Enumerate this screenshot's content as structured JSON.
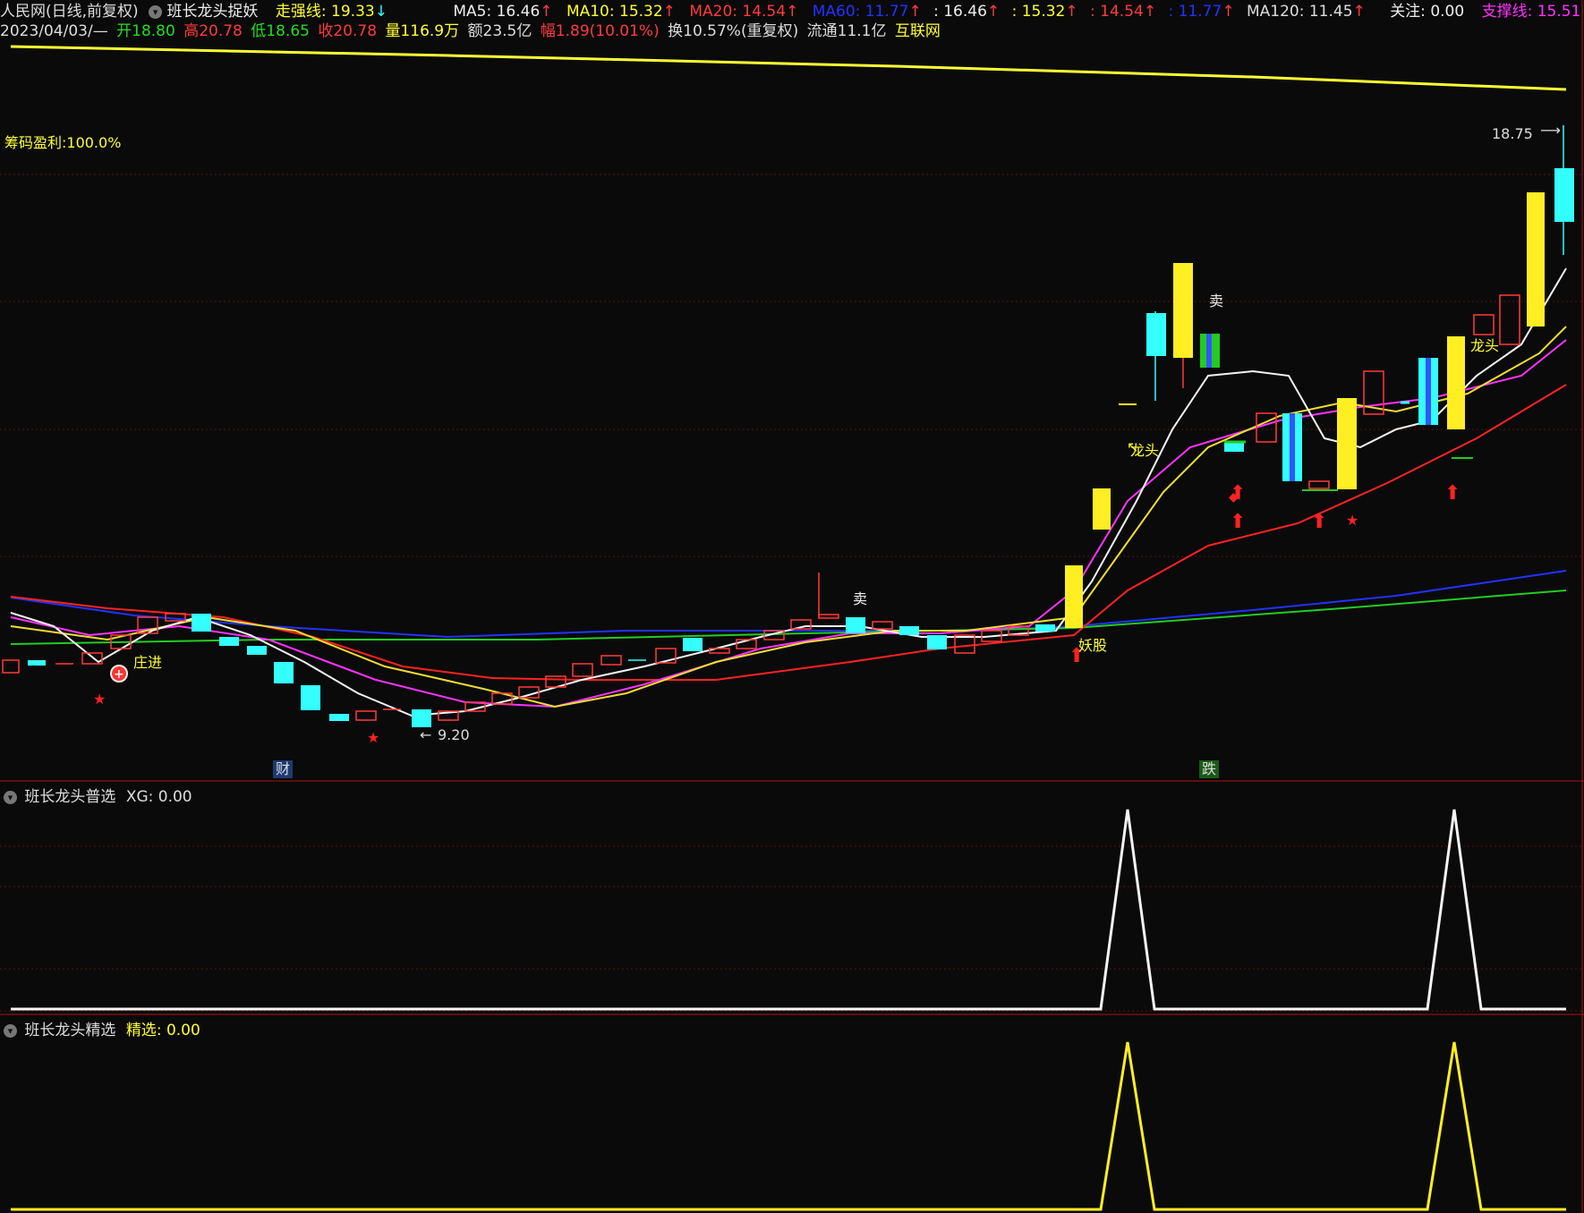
{
  "colors": {
    "bg": "#0a0a0a",
    "up": "#ff3b3b",
    "down": "#33ffff",
    "yellow": "#ffff33",
    "white": "#eeeeee",
    "magenta": "#ff33ff",
    "blue": "#2222ff",
    "green": "#22cc22",
    "grid": "#5a1010"
  },
  "header": {
    "title": "人民网(日线,前复权)",
    "indicator": "班长龙头捉妖",
    "strong_label": "走强线:",
    "strong_val": "19.33",
    "ma5": "MA5: 16.46",
    "ma10": "MA10: 15.32",
    "ma20": "MA20: 14.54",
    "ma60": "MA60: 11.77",
    "v1": ": 16.46",
    "v2": ": 15.32",
    "v3": ": 14.54",
    "v4": ": 11.77",
    "ma120": "MA120: 11.45",
    "focus": "关注: 0.00",
    "support": "支撑线: 15.51"
  },
  "quote": {
    "date": "2023/04/03/—",
    "open": "开18.80",
    "high": "高20.78",
    "low": "低18.65",
    "close": "收20.78",
    "vol": "量116.9万",
    "amount": "额23.5亿",
    "change": "幅1.89(10.01%)",
    "turnover": "换10.57%(重复权)",
    "float": "流通11.1亿",
    "source": "互联网"
  },
  "labels": {
    "profit": "筹码盈利:100.0%",
    "price_high": "18.75",
    "price_low": "9.20",
    "zhuangjin": "庄进",
    "longtou1": "龙头",
    "longtou2": "龙头",
    "yaogu": "妖股",
    "sell1": "卖",
    "sell2": "卖",
    "cai": "财",
    "die": "跌"
  },
  "panel2": {
    "name": "班长龙头普选",
    "value": "XG: 0.00"
  },
  "panel3": {
    "name": "班长龙头精选",
    "label": "精选",
    "value": ": 0.00"
  }
}
